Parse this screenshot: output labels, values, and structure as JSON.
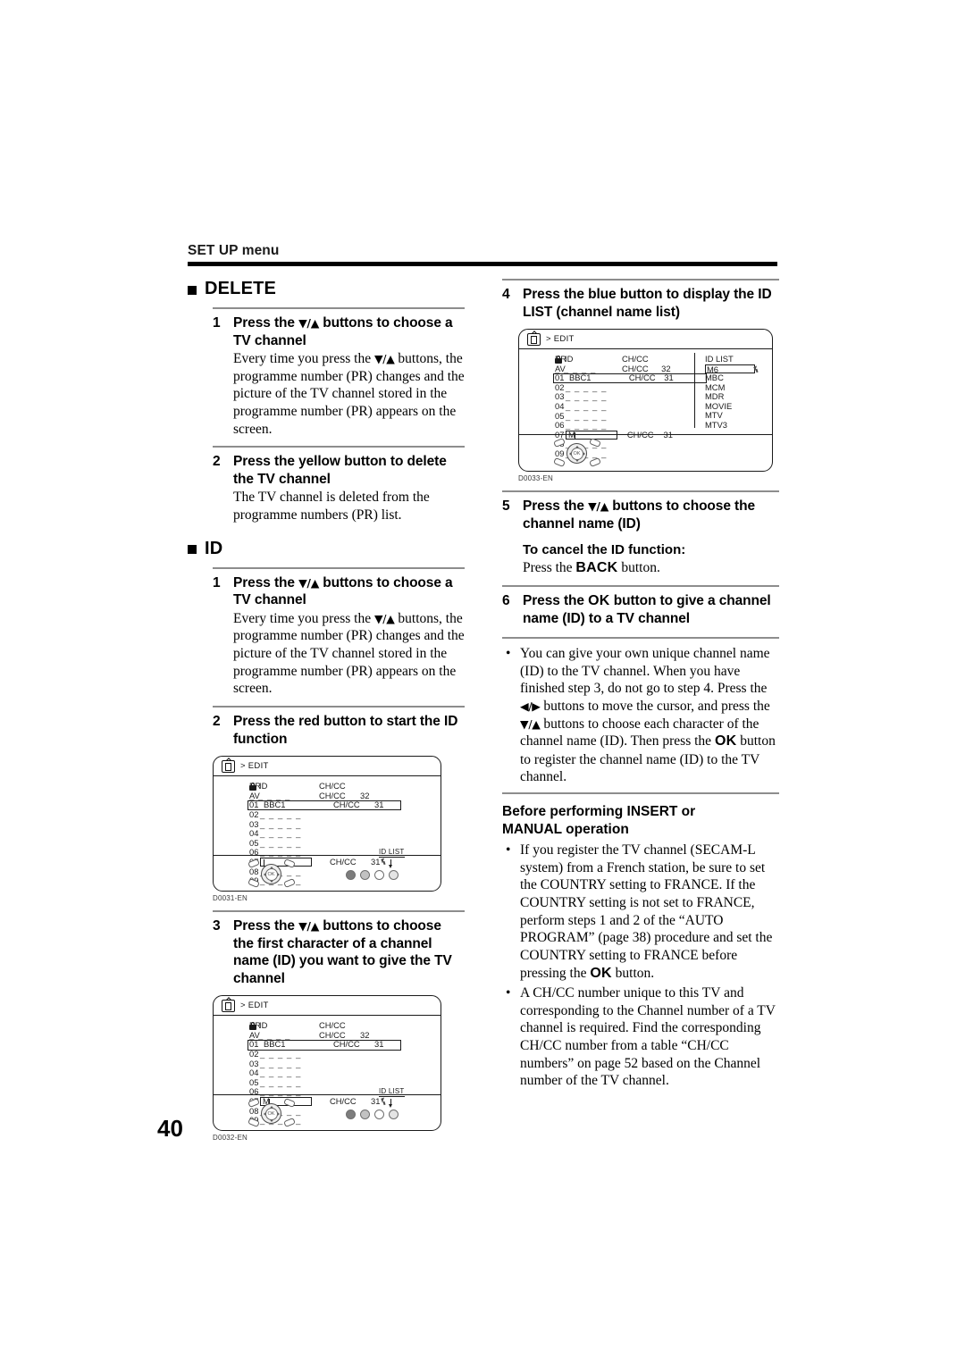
{
  "header": {
    "title": "SET UP menu"
  },
  "page_number": "40",
  "sections": {
    "delete": {
      "heading": "DELETE",
      "steps": [
        {
          "num": "1",
          "title_a": "Press the ",
          "title_arrows": "▼/▲",
          "title_b": " buttons to choose a TV channel",
          "desc_a": "Every time you press the ",
          "desc_arrows": "▼/▲",
          "desc_b": " buttons, the programme number (PR) changes and the picture of the TV channel stored in the programme number (PR) appears on the screen."
        },
        {
          "num": "2",
          "title": "Press the yellow button to delete the TV channel",
          "desc": "The TV channel is deleted from the programme numbers (PR) list."
        }
      ]
    },
    "id": {
      "heading": "ID",
      "steps": [
        {
          "num": "1",
          "title_a": "Press the ",
          "title_arrows": "▼/▲",
          "title_b": " buttons to choose a TV channel",
          "desc_a": "Every time you press the ",
          "desc_arrows": "▼/▲",
          "desc_b": " buttons, the programme number (PR) changes and the picture of the TV channel stored in the programme number (PR) appears on the screen."
        },
        {
          "num": "2",
          "title": "Press the red button to start the ID function"
        },
        {
          "num": "3",
          "title_a": "Press the ",
          "title_arrows": "▼/▲",
          "title_b": " buttons to choose the first character of a channel name (ID) you want to give the TV channel"
        },
        {
          "num": "4",
          "title": "Press the blue button to display the ID LIST (channel name list)"
        },
        {
          "num": "5",
          "title_a": "Press the ",
          "title_arrows": "▼/▲",
          "title_b": " buttons to choose the channel name (ID)",
          "sub_title": "To cancel the ID function:",
          "note_a": "Press the ",
          "note_kbd": "BACK",
          "note_b": " button."
        },
        {
          "num": "6",
          "title_a": "Press the ",
          "title_kbd": "OK",
          "title_b": " button to give a channel name (ID) to a TV channel"
        }
      ],
      "step6_note": {
        "t1": "You can give your own unique channel name (ID) to the TV channel. When you have finished step 3, do not go to step 4. Press the ",
        "arrows_lr": "◀/▶",
        "t2": " buttons to move the cursor, and press the ",
        "arrows_du": "▼/▲",
        "t3": " buttons to choose each character of the channel name (ID). Then press the ",
        "kbd": "OK",
        "t4": " button to register the channel name (ID) to the TV channel."
      }
    },
    "before_insert": {
      "heading_line1": "Before performing INSERT or",
      "heading_line2": "MANUAL operation",
      "bullets": [
        {
          "t1": "If you register the TV channel (SECAM-L system) from a French station, be sure to set the COUNTRY setting to FRANCE. If the COUNTRY setting is not set to FRANCE, perform steps 1 and 2 of the “AUTO PROGRAM” (page 38) procedure and set the COUNTRY setting to FRANCE before pressing the ",
          "kbd": "OK",
          "t2": " button."
        },
        {
          "t1": "A CH/CC number unique to this TV and corresponding to the Channel number of a TV channel is required. Find the corresponding CH/CC number from a table “CH/CC numbers” on page 52 based on the Channel number of the TV channel.",
          "kbd": "",
          "t2": ""
        }
      ]
    }
  },
  "figures": {
    "d0031": {
      "code": "D0031-EN",
      "title": "> EDIT",
      "columns": {
        "pr": "PR",
        "id": "ID",
        "chcc": "CH/CC"
      },
      "rows": [
        {
          "pr": "AV",
          "id": "dashes",
          "chcc": "CH/CC",
          "num": "32",
          "selected": false
        },
        {
          "pr": "01",
          "id": "BBC1",
          "chcc": "CH/CC",
          "num": "31",
          "selected": true
        },
        {
          "pr": "02",
          "id": "dashes",
          "chcc": "",
          "num": "",
          "selected": false
        },
        {
          "pr": "03",
          "id": "dashes",
          "chcc": "",
          "num": "",
          "selected": false
        },
        {
          "pr": "04",
          "id": "dashes",
          "chcc": "",
          "num": "",
          "selected": false
        },
        {
          "pr": "05",
          "id": "dashes",
          "chcc": "",
          "num": "",
          "selected": false
        },
        {
          "pr": "06",
          "id": "dashes",
          "chcc": "",
          "num": "",
          "selected": false
        },
        {
          "pr": "07",
          "id": "editbox",
          "chcc": "CH/CC",
          "num": "31",
          "selected": false,
          "cursor_char": ""
        },
        {
          "pr": "08",
          "id": "dashes",
          "chcc": "",
          "num": "",
          "selected": false
        },
        {
          "pr": "09",
          "id": "dashes",
          "chcc": "",
          "num": "",
          "selected": false
        }
      ],
      "callout": "ID LIST",
      "ok_label": "OK"
    },
    "d0032": {
      "code": "D0032-EN",
      "title": "> EDIT",
      "columns": {
        "pr": "PR",
        "id": "ID",
        "chcc": "CH/CC"
      },
      "rows": [
        {
          "pr": "AV",
          "id": "dashes",
          "chcc": "CH/CC",
          "num": "32",
          "selected": false
        },
        {
          "pr": "01",
          "id": "BBC1",
          "chcc": "CH/CC",
          "num": "31",
          "selected": true
        },
        {
          "pr": "02",
          "id": "dashes",
          "chcc": "",
          "num": "",
          "selected": false
        },
        {
          "pr": "03",
          "id": "dashes",
          "chcc": "",
          "num": "",
          "selected": false
        },
        {
          "pr": "04",
          "id": "dashes",
          "chcc": "",
          "num": "",
          "selected": false
        },
        {
          "pr": "05",
          "id": "dashes",
          "chcc": "",
          "num": "",
          "selected": false
        },
        {
          "pr": "06",
          "id": "dashes",
          "chcc": "",
          "num": "",
          "selected": false
        },
        {
          "pr": "07",
          "id": "editbox",
          "chcc": "CH/CC",
          "num": "31",
          "selected": false,
          "cursor_char": "M"
        },
        {
          "pr": "08",
          "id": "dashes",
          "chcc": "",
          "num": "",
          "selected": false
        },
        {
          "pr": "09",
          "id": "dashes",
          "chcc": "",
          "num": "",
          "selected": false
        }
      ],
      "callout": "ID LIST",
      "ok_label": "OK"
    },
    "d0033": {
      "code": "D0033-EN",
      "title": "> EDIT",
      "columns": {
        "pr": "PR",
        "id": "ID",
        "chcc": "CH/CC"
      },
      "rows": [
        {
          "pr": "AV",
          "id": "dashes",
          "chcc": "CH/CC",
          "num": "32",
          "selected": false
        },
        {
          "pr": "01",
          "id": "BBC1",
          "chcc": "CH/CC",
          "num": "31",
          "selected": true
        },
        {
          "pr": "02",
          "id": "dashes",
          "chcc": "",
          "num": "",
          "selected": false
        },
        {
          "pr": "03",
          "id": "dashes",
          "chcc": "",
          "num": "",
          "selected": false
        },
        {
          "pr": "04",
          "id": "dashes",
          "chcc": "",
          "num": "",
          "selected": false
        },
        {
          "pr": "05",
          "id": "dashes",
          "chcc": "",
          "num": "",
          "selected": false
        },
        {
          "pr": "06",
          "id": "dashes",
          "chcc": "",
          "num": "",
          "selected": false
        },
        {
          "pr": "07",
          "id": "editbox",
          "chcc": "CH/CC",
          "num": "31",
          "selected": false,
          "cursor_char": "M"
        },
        {
          "pr": "08",
          "id": "dashes",
          "chcc": "",
          "num": "",
          "selected": false
        },
        {
          "pr": "09",
          "id": "dashes",
          "chcc": "",
          "num": "",
          "selected": false
        }
      ],
      "id_list": {
        "title": "ID LIST",
        "selected": "M6",
        "items": [
          "MBC",
          "MCM",
          "MDR",
          "MOVIE",
          "MTV",
          "MTV3"
        ]
      },
      "ok_label": "OK"
    }
  }
}
